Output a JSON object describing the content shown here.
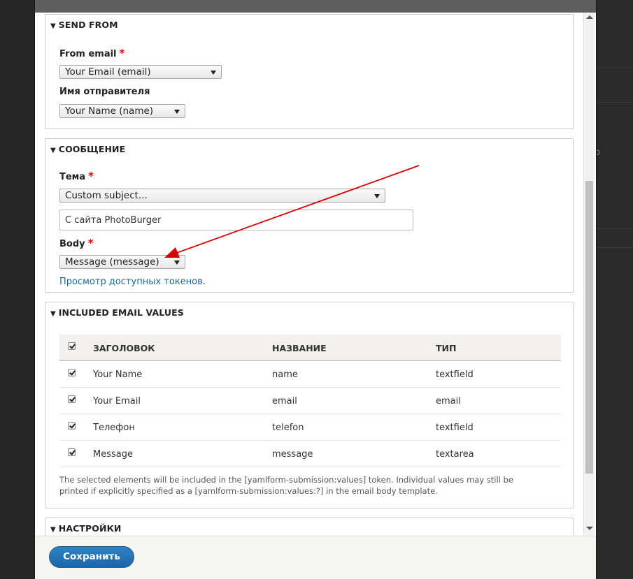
{
  "send_from": {
    "legend": "SEND FROM",
    "from_email_label": "From email",
    "from_email_value": "Your Email (email)",
    "sender_name_label": "Имя отправителя",
    "sender_name_value": "Your Name (name)"
  },
  "message": {
    "legend": "СООБЩЕНИЕ",
    "subject_label": "Тема",
    "subject_select_value": "Custom subject...",
    "subject_text_value": "С сайта PhotoBurger",
    "body_label": "Body",
    "body_value": "Message (message)",
    "tokens_link": "Просмотр доступных токенов",
    "tokens_link_suffix": "."
  },
  "included": {
    "legend": "INCLUDED EMAIL VALUES",
    "columns": [
      "ЗАГОЛОВОК",
      "НАЗВАНИЕ",
      "ТИП"
    ],
    "rows": [
      {
        "title": "Your Name",
        "name": "name",
        "type": "textfield",
        "checked": true
      },
      {
        "title": "Your Email",
        "name": "email",
        "type": "email",
        "checked": true
      },
      {
        "title": "Телефон",
        "name": "telefon",
        "type": "textfield",
        "checked": true
      },
      {
        "title": "Message",
        "name": "message",
        "type": "textarea",
        "checked": true
      }
    ],
    "description_line1": "The selected elements will be included in the [yamlform-submission:values] token. Individual values may still be",
    "description_line2": "printed if explicitly specified as a [yamlform-submission:values:?] in the email body template."
  },
  "settings": {
    "legend": "НАСТРОЙКИ"
  },
  "footer": {
    "save_label": "Сохранить"
  },
  "required_mark": "*",
  "colors": {
    "accent": "#1c66a8",
    "required": "#e00000",
    "annotation_arrow": "#d40000"
  },
  "backdrop_glyph": "o"
}
